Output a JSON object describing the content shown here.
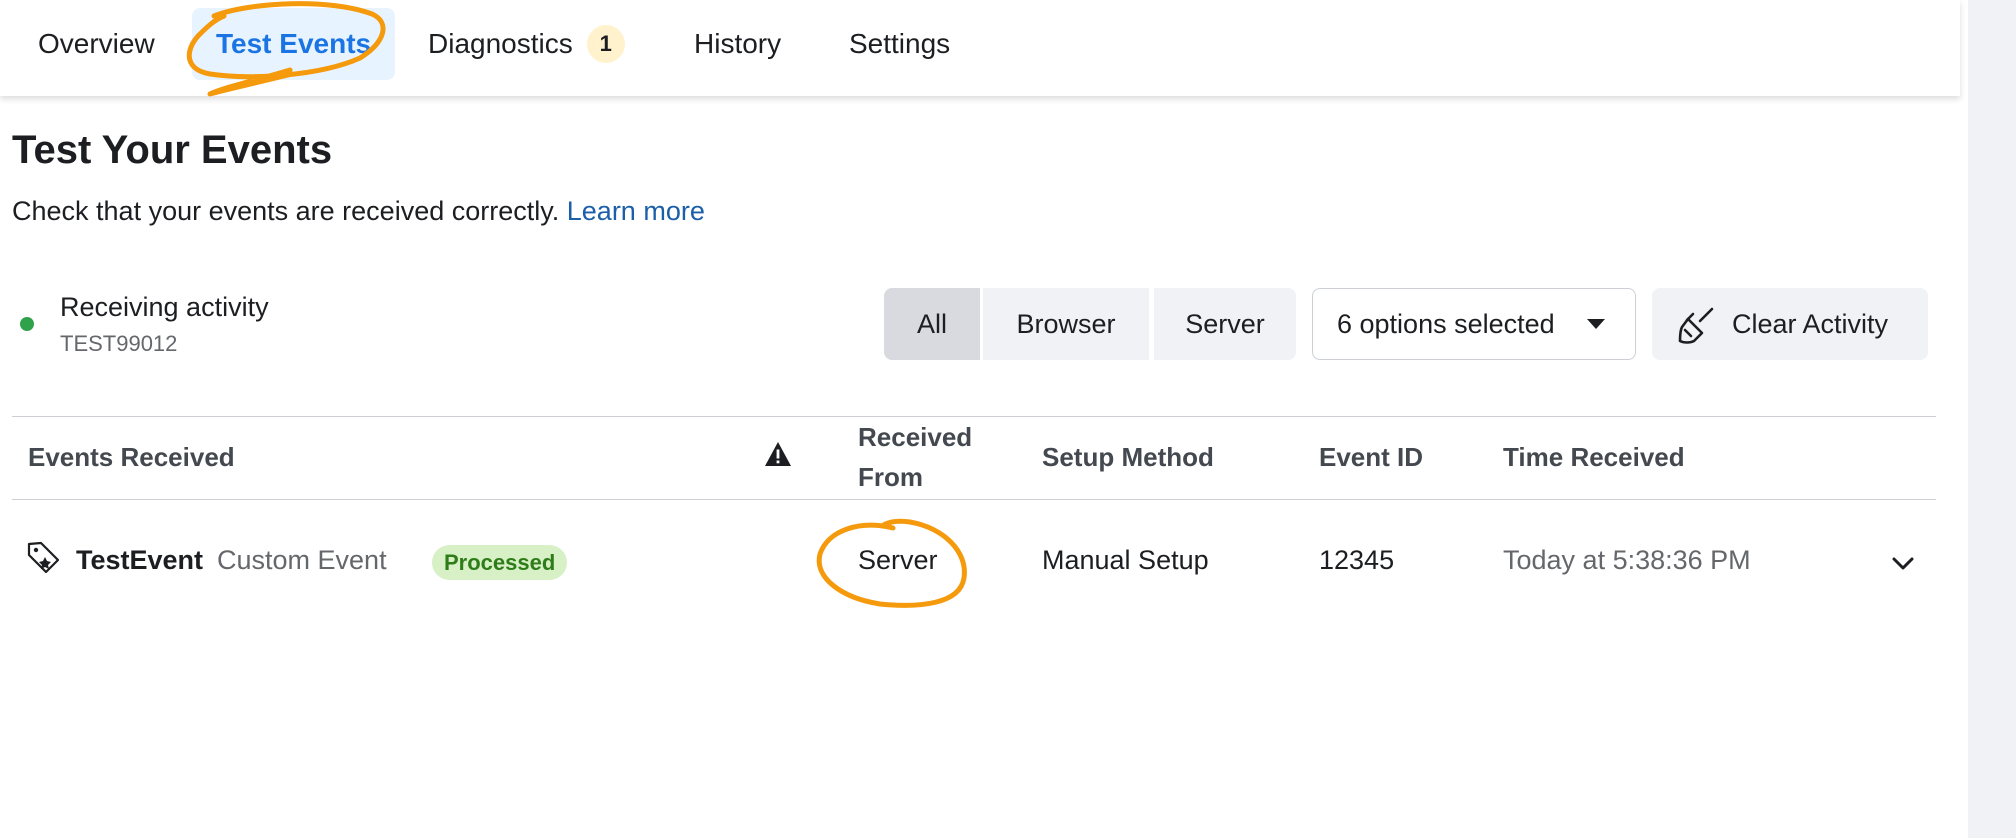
{
  "tabs": [
    {
      "label": "Overview",
      "active": false
    },
    {
      "label": "Test Events",
      "active": true
    },
    {
      "label": "Diagnostics",
      "active": false,
      "badge": "1"
    },
    {
      "label": "History",
      "active": false
    },
    {
      "label": "Settings",
      "active": false
    }
  ],
  "header": {
    "title": "Test Your Events",
    "subtitle": "Check that your events are received correctly.",
    "learn_more": "Learn more"
  },
  "status": {
    "label": "Receiving activity",
    "code": "TEST99012",
    "color": "#31a24c"
  },
  "filters": {
    "segments": [
      "All",
      "Browser",
      "Server"
    ],
    "selected": "All",
    "dropdown_label": "6 options selected",
    "clear_label": "Clear Activity"
  },
  "table": {
    "headers": {
      "events_received": "Events Received",
      "received_from_1": "Received",
      "received_from_2": "From",
      "setup_method": "Setup Method",
      "event_id": "Event ID",
      "time_received": "Time Received"
    },
    "rows": [
      {
        "event_name": "TestEvent",
        "event_type": "Custom Event",
        "status": "Processed",
        "received_from": "Server",
        "setup_method": "Manual Setup",
        "event_id": "12345",
        "time_received": "Today at 5:38:36 PM"
      }
    ]
  },
  "icons": {
    "warning": "warning-icon",
    "tag": "event-tag-icon",
    "broom": "broom-icon",
    "caret": "caret-down-icon",
    "chevron": "chevron-down-icon"
  },
  "colors": {
    "accent": "#1b74e4",
    "annotation": "#f59a0c",
    "processed_bg": "#d7f0c6",
    "processed_text": "#2e7d19"
  }
}
